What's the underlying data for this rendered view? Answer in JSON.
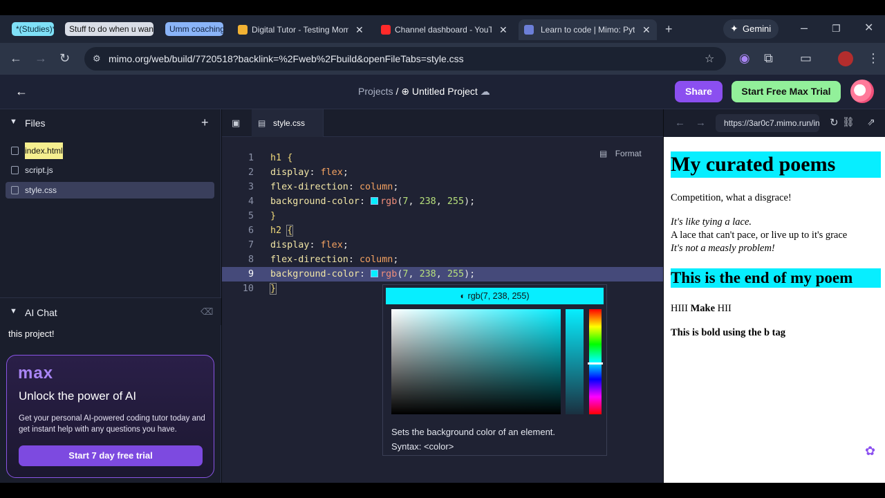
{
  "browser": {
    "tab_groups": [
      "*(Studies)*",
      "Stuff to do when u wann",
      "Umm coaching"
    ],
    "tabs": [
      {
        "title": "Digital Tutor - Testing Mom"
      },
      {
        "title": "Channel dashboard - YouTu"
      },
      {
        "title": "Learn to code | Mimo: Pytho"
      }
    ],
    "gemini_label": "Gemini",
    "url": "mimo.org/web/build/7720518?backlink=%2Fweb%2Fbuild&openFileTabs=style.css"
  },
  "header": {
    "breadcrumb_projects": "Projects",
    "breadcrumb_sep": "/",
    "project_name": "Untitled Project",
    "share_label": "Share",
    "trial_label": "Start Free Max Trial"
  },
  "sidebar": {
    "files_title": "Files",
    "files": [
      "index.html",
      "script.js",
      "style.css"
    ],
    "ai_chat_title": "AI Chat",
    "chat_message": "this project!",
    "max_card": {
      "logo": "max",
      "heading": "Unlock the power of AI",
      "body": "Get your personal AI-powered coding tutor today and get instant help with any questions you have.",
      "button": "Start 7 day free trial"
    }
  },
  "editor": {
    "tab_name": "style.css",
    "format_label": "Format",
    "current_line": 9,
    "lines": [
      {
        "n": "1",
        "text": "h1 {"
      },
      {
        "n": "2",
        "text": "display: flex;"
      },
      {
        "n": "3",
        "text": "flex-direction: column;"
      },
      {
        "n": "4",
        "text": "background-color: rgb(7, 238, 255);"
      },
      {
        "n": "5",
        "text": "}"
      },
      {
        "n": "6",
        "text": "h2 {"
      },
      {
        "n": "7",
        "text": "display: flex;"
      },
      {
        "n": "8",
        "text": "flex-direction: column;"
      },
      {
        "n": "9",
        "text": "background-color: rgb(7, 238, 255);"
      },
      {
        "n": "10",
        "text": "}"
      }
    ],
    "color_picker": {
      "value": "rgb(7, 238, 255)",
      "color": "#07eeff",
      "description": "Sets the background color of an element.",
      "syntax": "Syntax: <color>"
    }
  },
  "preview": {
    "url": "https://3ar0c7.mimo.run/in",
    "h1": "My curated poems",
    "p1": "Competition, what a disgrace!",
    "p2_line1": "It's like tying a lace.",
    "p2_line2": "A lace that can't pace, or live up to it's grace",
    "p2_line3": "It's not a measly problem!",
    "h2": "This is the end of my poem",
    "p3_prefix": "HIII ",
    "p3_bold": "Make",
    "p3_suffix": " HII",
    "p4": "This is bold using the b tag"
  },
  "colors": {
    "accent_purple": "#8b4ff0",
    "trial_green": "#92f09a",
    "cyan": "#07eeff"
  }
}
